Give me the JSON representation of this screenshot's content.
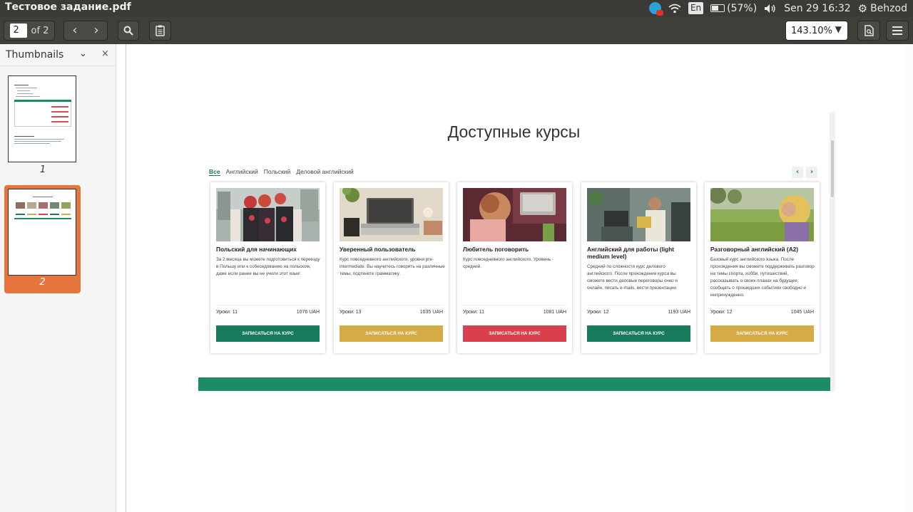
{
  "window": {
    "title": "Тестовое задание.pdf"
  },
  "system_tray": {
    "language": "En",
    "battery": "(57%)",
    "battery_level": 0.57,
    "datetime": "Sen 29 16:32",
    "user": "Behzod",
    "icons": [
      "telegram-icon",
      "wifi-icon",
      "battery-icon",
      "volume-icon",
      "power-icon"
    ]
  },
  "toolbar": {
    "page_current": "2",
    "page_total": "of 2",
    "zoom": "143.10%",
    "prev_icon": "‹",
    "next_icon": "›"
  },
  "sidebar": {
    "title": "Thumbnails",
    "pages": [
      {
        "number": "1",
        "selected": false
      },
      {
        "number": "2",
        "selected": true
      }
    ]
  },
  "document": {
    "heading": "Доступные курсы",
    "tabs": [
      "Все",
      "Английский",
      "Польский",
      "Деловой английский"
    ],
    "active_tab": "Все",
    "cards": [
      {
        "title": "Польский для начинающих",
        "description": "За 2 месяца вы можете подготовиться к переезду в Польшу или к собеседованию на польском, даже если ранее вы не учили этот язык!",
        "lessons": "Уроки: 11",
        "price": "1076 UAH",
        "button": "ЗАПИСАТЬСЯ НА КУРС",
        "button_color": "#177a5d"
      },
      {
        "title": "Уверенный пользователь",
        "description": "Курс повседневного английского, уровня pre-intermediate. Вы научитесь говорить на различные темы, подтянете грамматику.",
        "lessons": "Уроки: 13",
        "price": "1035 UAH",
        "button": "ЗАПИСАТЬСЯ НА КУРС",
        "button_color": "#d4ab45"
      },
      {
        "title": "Любитель поговорить",
        "description": "Курс повседневного английского. Уровень - средний.",
        "lessons": "Уроки: 11",
        "price": "1081 UAH",
        "button": "ЗАПИСАТЬСЯ НА КУРС",
        "button_color": "#d9404e"
      },
      {
        "title": "Английский для работы (light medium level)",
        "description": "Средний по сложности курс делового английского. После прохождения курса вы сможете вести деловые переговоры очно и онлайн, писать e-mails, вести презентации.",
        "lessons": "Уроки: 12",
        "price": "1193 UAH",
        "button": "ЗАПИСАТЬСЯ НА КУРС",
        "button_color": "#177a5d"
      },
      {
        "title": "Разговорный английский (A2)",
        "description": "Базовый курс английского языка. После прохождения вы сможете поддерживать разговор на темы спорта, хобби, путешествий, рассказывать о своих планах на будущее, сообщать о прошедших событиях свободно и непринужденно.",
        "lessons": "Уроки: 12",
        "price": "1045 UAH",
        "button": "ЗАПИСАТЬСЯ НА КУРС",
        "button_color": "#d4ab45"
      }
    ]
  }
}
